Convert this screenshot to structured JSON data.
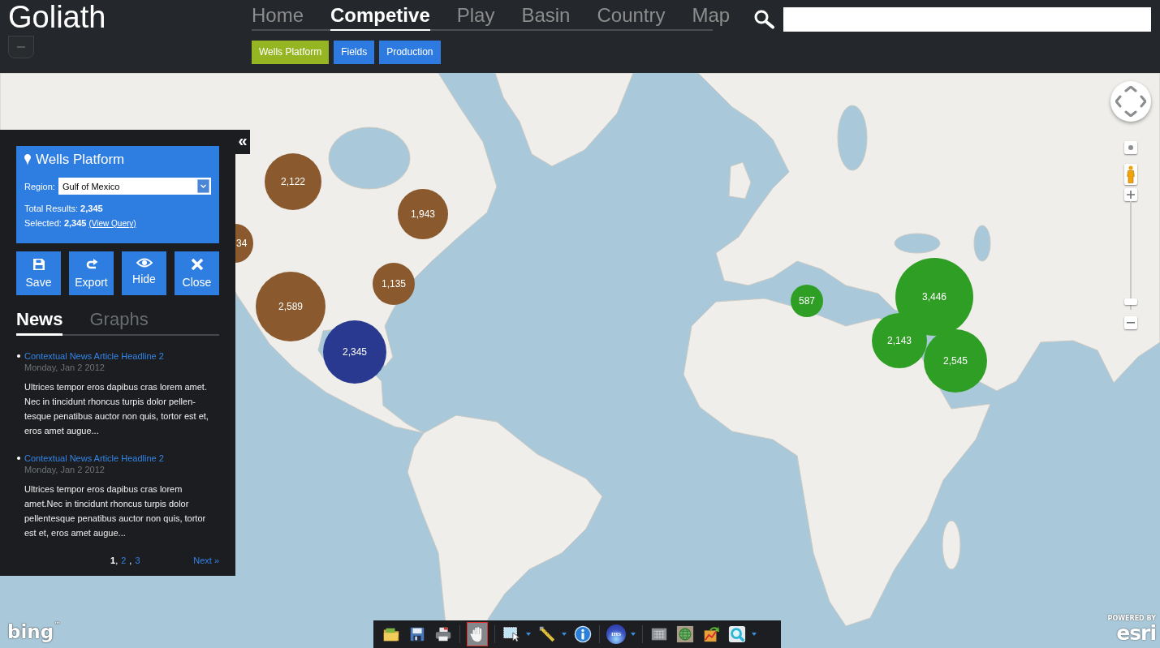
{
  "app": {
    "logo": "Goliath"
  },
  "nav": {
    "tabs": [
      {
        "label": "Home",
        "selected": false
      },
      {
        "label": "Competive",
        "selected": true
      },
      {
        "label": "Play",
        "selected": false
      },
      {
        "label": "Basin",
        "selected": false
      },
      {
        "label": "Country",
        "selected": false
      },
      {
        "label": "Map",
        "selected": false
      }
    ],
    "subtabs": [
      {
        "label": "Wells Platform",
        "selected": true
      },
      {
        "label": "Fields",
        "selected": false
      },
      {
        "label": "Production",
        "selected": false
      }
    ]
  },
  "map": {
    "markers": [
      {
        "label": "2,122",
        "color": "#8a5a2e"
      },
      {
        "label": "1,943",
        "color": "#8a5a2e"
      },
      {
        "label": "34",
        "color": "#8a5a2e"
      },
      {
        "label": "1,135",
        "color": "#8a5a2e"
      },
      {
        "label": "2,589",
        "color": "#8a5a2e"
      },
      {
        "label": "2,345",
        "color": "#28398f"
      },
      {
        "label": "587",
        "color": "#2f9e24"
      },
      {
        "label": "3,446",
        "color": "#2f9e24"
      },
      {
        "label": "2,143",
        "color": "#2f9e24"
      },
      {
        "label": "2,545",
        "color": "#2f9e24"
      }
    ],
    "logos": {
      "bing": "bing$^{™}$",
      "esri_caption": "POWERED BY",
      "esri": "esri"
    }
  },
  "map_controls": {
    "zoom_slider": {
      "level": 0.05
    }
  },
  "panel": {
    "collapse": "«",
    "title": "Wells Platform",
    "region_label": "Region:",
    "region": "Gulf of Mexico",
    "total": "Total Results: **2,345**",
    "selection": "Selected: **2,345**",
    "view_query": "(View Query)",
    "actions": [
      "Save",
      "Export",
      "Hide",
      "Close"
    ],
    "tabs": [
      {
        "label": "News",
        "selected": true
      },
      {
        "label": "Graphs",
        "selected": false
      }
    ],
    "news": [
      {
        "headline": "Contextual News Article Headline 2",
        "date": "Monday, Jan 2 2012",
        "body": "Ultrices tempor eros dapibus cras lorem amet. Nec in tincidunt rhoncus turpis dolor pellen-tesque penatibus auctor non quis, tortor est et, eros amet augue..."
      },
      {
        "headline": "Contextual News Article Headline 2",
        "date": "Monday, Jan 2 2012",
        "body": "Ultrices tempor eros dapibus cras lorem amet.Nec in tincidunt rhoncus turpis dolor pellentesque penatibus auctor non quis, tortor est et, eros amet augue..."
      }
    ],
    "pagination": {
      "pages": [
        {
          "label": "1",
          "selected": true,
          "separator": ","
        },
        {
          "label": "2",
          "selected": false,
          "separator": ","
        },
        {
          "label": "3",
          "selected": false
        }
      ],
      "next": "Next »"
    }
  },
  "toolbar": {
    "groups": [
      {
        "tools": [
          {
            "selected": false,
            "menu": false
          },
          {
            "selected": false,
            "menu": false
          },
          {
            "selected": false,
            "menu": false
          }
        ]
      },
      {
        "tools": [
          {
            "selected": true,
            "menu": false
          }
        ]
      },
      {
        "tools": [
          {
            "selected": false,
            "menu": true
          },
          {
            "selected": false,
            "menu": true
          },
          {
            "selected": false,
            "menu": false
          }
        ]
      },
      {
        "tools": [
          {
            "selected": false,
            "menu": true,
            "text": "IHS"
          }
        ]
      },
      {
        "tools": [
          {
            "selected": false,
            "menu": false
          },
          {
            "selected": false,
            "menu": false
          },
          {
            "selected": false,
            "menu": false
          },
          {
            "selected": false,
            "menu": true
          }
        ]
      }
    ]
  }
}
